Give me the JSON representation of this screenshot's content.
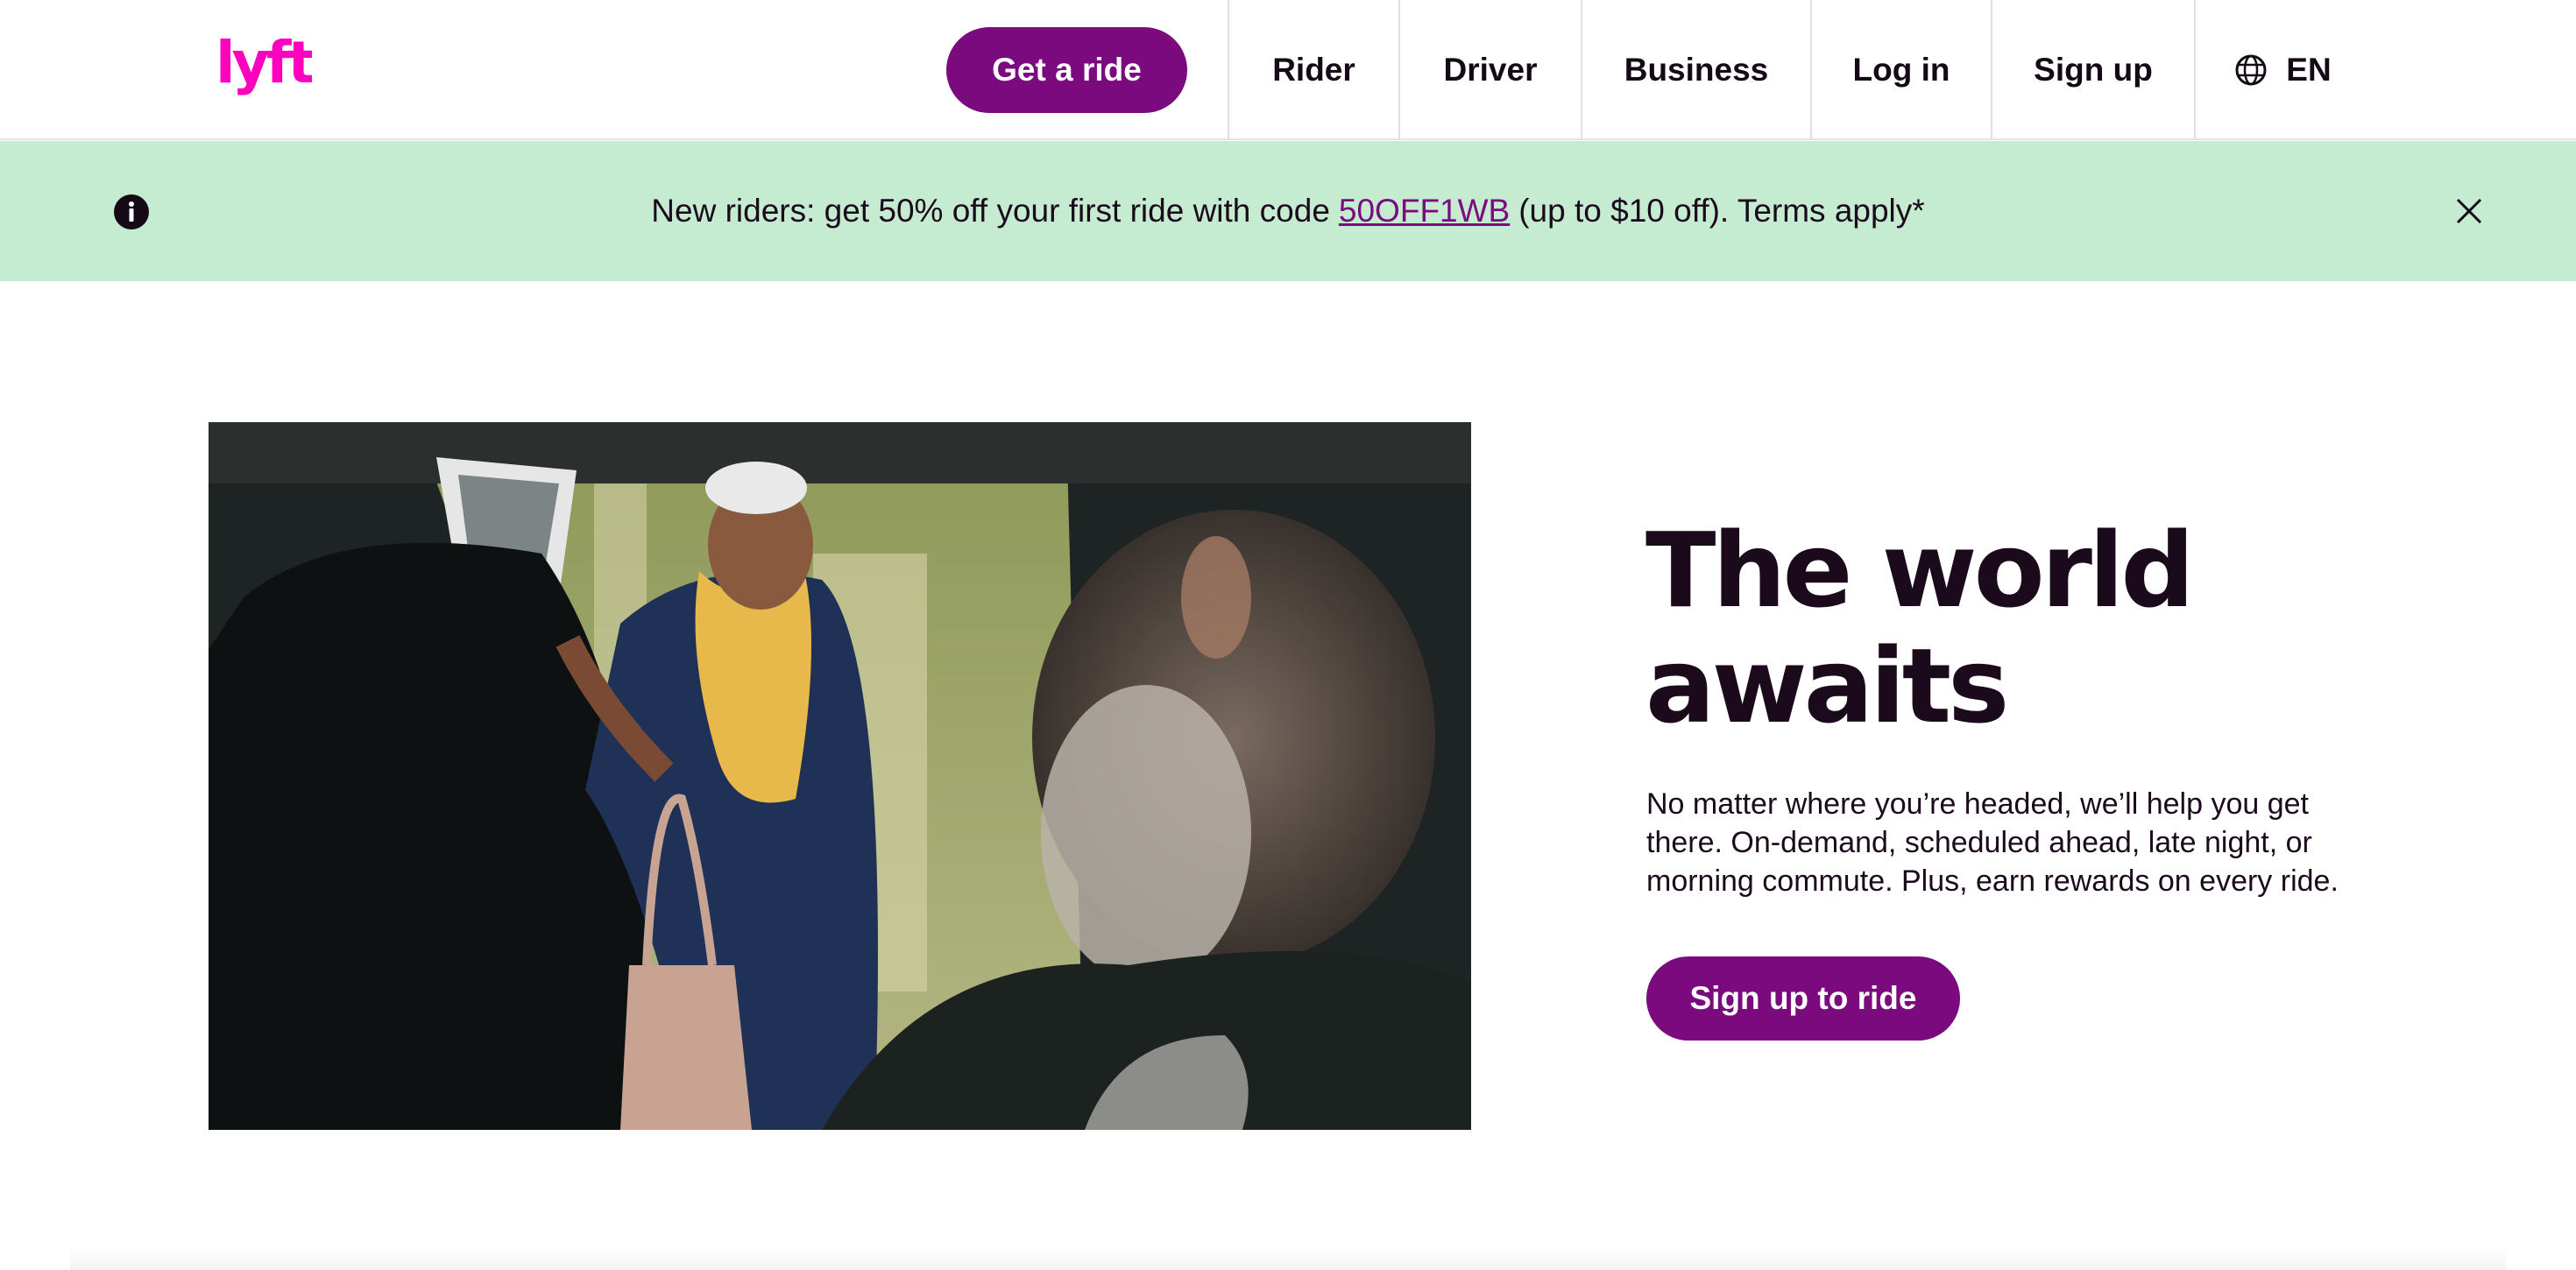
{
  "header": {
    "logo_text": "lyft",
    "get_ride_label": "Get a ride",
    "nav": {
      "rider": "Rider",
      "driver": "Driver",
      "business": "Business",
      "login": "Log in",
      "signup": "Sign up",
      "language": "EN"
    }
  },
  "banner": {
    "text_before": "New riders: get 50% off your first ride with code",
    "promo_code": "50OFF1WB",
    "text_after": "(up to $10 off). Terms apply*"
  },
  "hero": {
    "headline_line1": "The world",
    "headline_line2": "awaits",
    "subtext": "No matter where you’re headed, we’ll help you get there. On-demand, scheduled ahead, late night, or morning commute. Plus, earn rewards on every ride.",
    "cta_label": "Sign up to ride"
  },
  "colors": {
    "brand_magenta": "#ff00bf",
    "primary_purple": "#7a0a7e",
    "banner_green": "#c5ecd1",
    "text_dark": "#1a0a1c"
  },
  "icons": {
    "info": "info-icon",
    "close": "close-icon",
    "globe": "globe-icon"
  }
}
